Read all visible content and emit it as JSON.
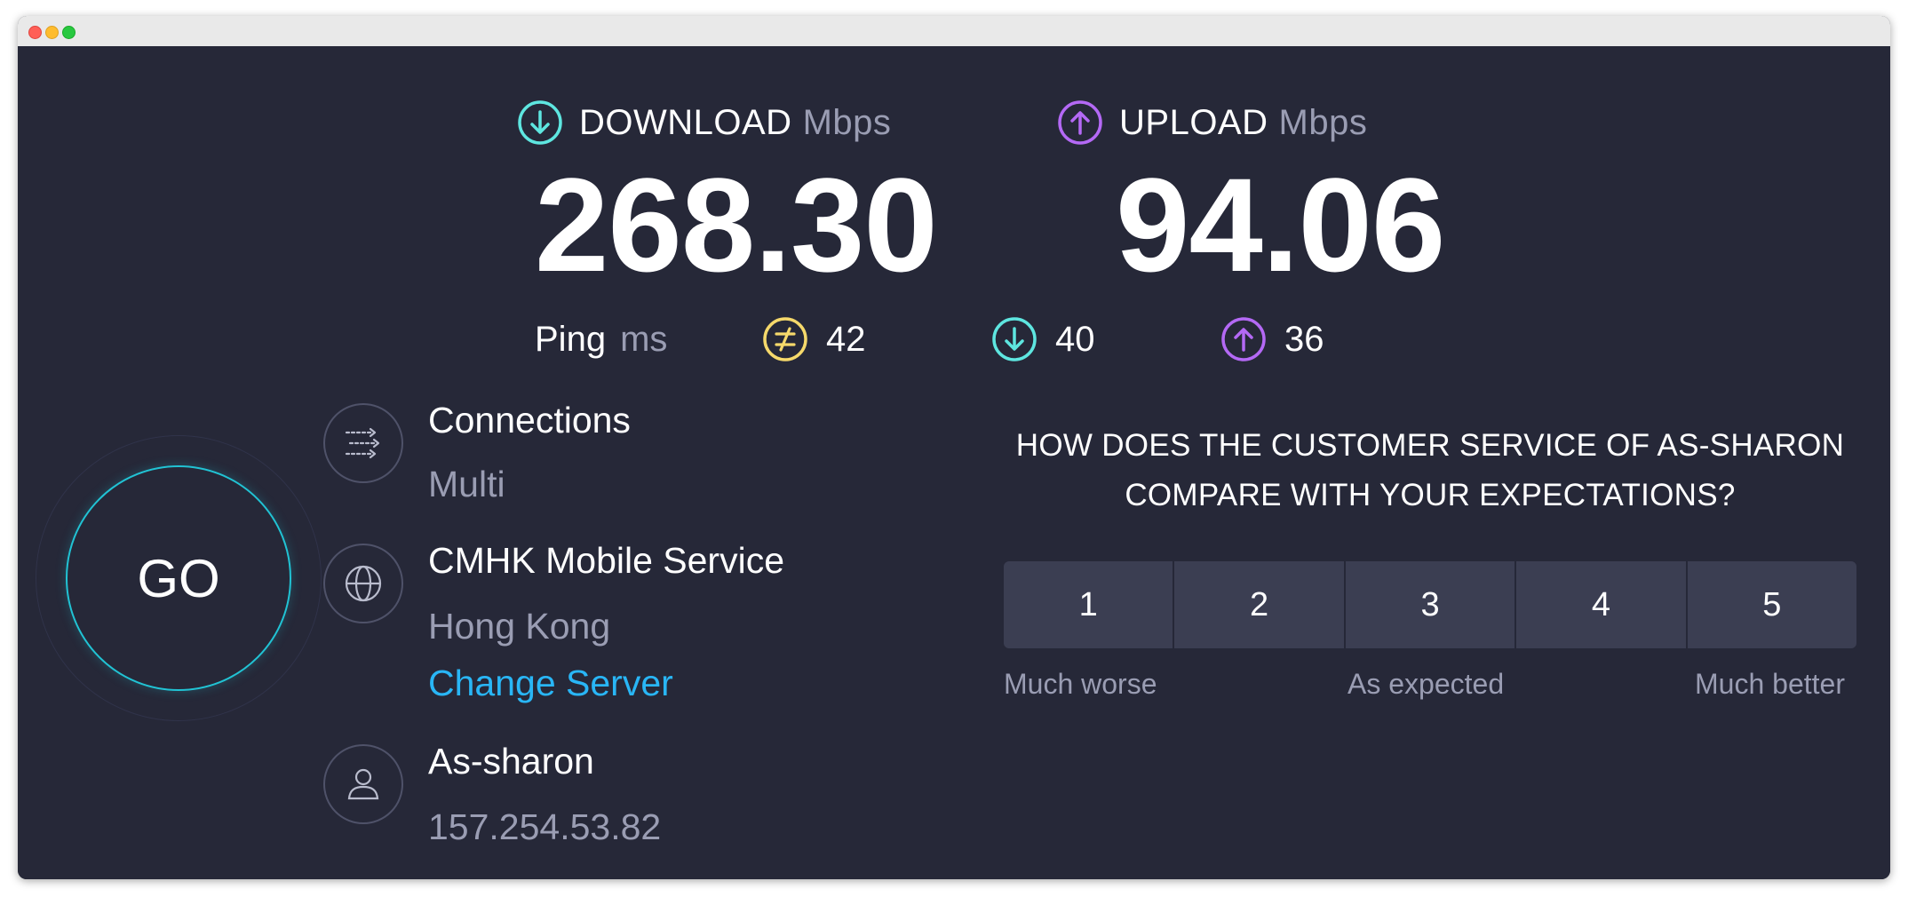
{
  "colors": {
    "background": "#262838",
    "accent_cyan": "#21c3d4",
    "download_icon": "#5ee6e0",
    "upload_icon": "#b469f5",
    "jitter_icon": "#f6d96b",
    "link": "#29b6f6",
    "muted_text": "#9a9db3",
    "rating_button": "#3b3e52"
  },
  "download": {
    "icon": "arrow-down-circle-icon",
    "label": "DOWNLOAD",
    "unit": "Mbps",
    "value": "268.30"
  },
  "upload": {
    "icon": "arrow-up-circle-icon",
    "label": "UPLOAD",
    "unit": "Mbps",
    "value": "94.06"
  },
  "ping": {
    "label": "Ping",
    "unit": "ms",
    "idle": {
      "icon": "jitter-icon",
      "value": "42"
    },
    "download": {
      "icon": "arrow-down-circle-icon",
      "value": "40"
    },
    "upload": {
      "icon": "arrow-up-circle-icon",
      "value": "36"
    }
  },
  "go_button": {
    "label": "GO"
  },
  "connections": {
    "icon": "connections-arrows-icon",
    "title": "Connections",
    "value": "Multi"
  },
  "server": {
    "icon": "globe-icon",
    "name": "CMHK Mobile Service",
    "location": "Hong Kong",
    "change_label": "Change Server"
  },
  "provider": {
    "icon": "user-icon",
    "name": "As-sharon",
    "ip": "157.254.53.82"
  },
  "survey": {
    "question_line1": "HOW DOES THE CUSTOMER SERVICE OF AS-SHARON",
    "question_line2": "COMPARE WITH YOUR EXPECTATIONS?",
    "options": [
      "1",
      "2",
      "3",
      "4",
      "5"
    ],
    "low_label": "Much worse",
    "mid_label": "As expected",
    "high_label": "Much better"
  }
}
